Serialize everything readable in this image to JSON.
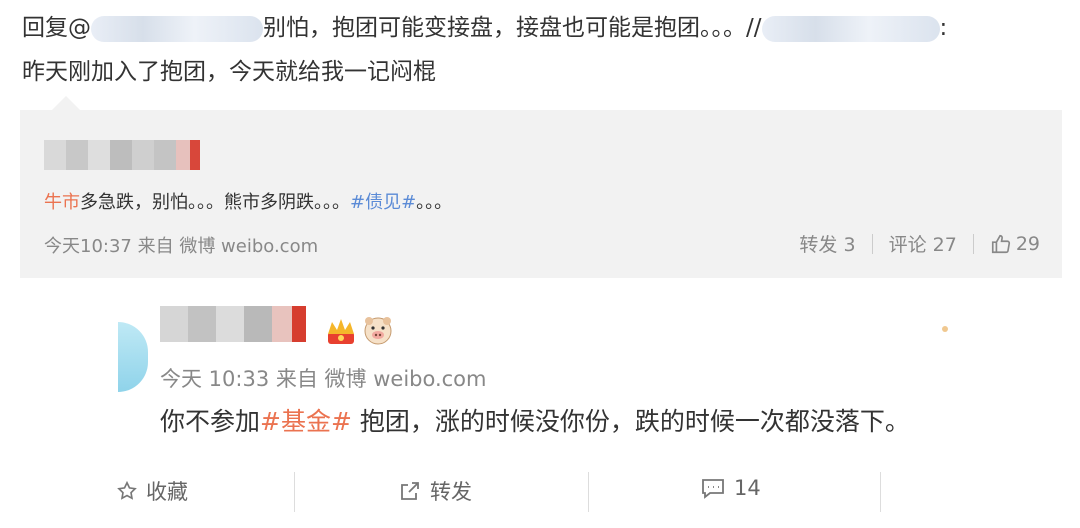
{
  "reply": {
    "prefix": "回复@",
    "text_part1": "别怕，抱团可能变接盘，接盘也可能是抱团。。。//",
    "colon": ":",
    "line2": "昨天刚加入了抱团，今天就给我一记闷棍"
  },
  "original_post": {
    "text_orange": "牛市",
    "text_mid": "多急跌，别怕。。。熊市多阴跌。。。",
    "hashtag": "#债见#",
    "text_end": "。。。",
    "meta": "今天10:37 来自 微博 weibo.com",
    "actions": {
      "repost_label": "转发",
      "repost_count": "3",
      "comment_label": "评论",
      "comment_count": "27",
      "like_count": "29"
    }
  },
  "quoted_post": {
    "meta": "今天 10:33 来自 微博 weibo.com",
    "text_before": "你不参加",
    "hashtag": "#基金#",
    "text_after": " 抱团，涨的时候没你份，跌的时候一次都没落下。",
    "bottom_actions": {
      "favorite_label": "收藏",
      "repost_label": "转发",
      "comment_count": "14"
    }
  },
  "colors": {
    "accent_orange": "#eb7350",
    "hashtag_blue": "#5b8bd6",
    "meta_gray": "#888888"
  }
}
